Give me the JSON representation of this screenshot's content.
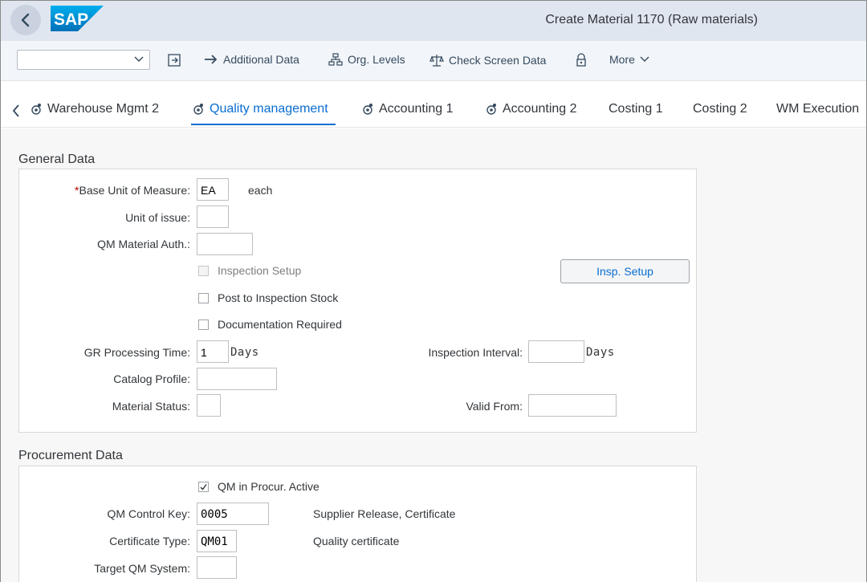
{
  "shell": {
    "title": "Create Material 1170 (Raw materials)",
    "logo_text": "SAP"
  },
  "toolbar": {
    "select_value": "",
    "additional_data": "Additional Data",
    "org_levels": "Org. Levels",
    "check_screen_data": "Check Screen Data",
    "more": "More"
  },
  "tabs": [
    {
      "label": "Warehouse Mgmt 2",
      "icon": "gear-icon"
    },
    {
      "label": "Quality management",
      "icon": "gear-icon",
      "active": true
    },
    {
      "label": "Accounting 1",
      "icon": "gear-icon"
    },
    {
      "label": "Accounting 2",
      "icon": "gear-icon"
    },
    {
      "label": "Costing 1"
    },
    {
      "label": "Costing 2"
    },
    {
      "label": "WM Execution"
    }
  ],
  "general": {
    "title": "General Data",
    "base_uom": {
      "label": "Base Unit of Measure:",
      "value": "EA",
      "text": "each",
      "required": true
    },
    "unit_of_issue": {
      "label": "Unit of issue:",
      "value": ""
    },
    "qm_material_auth": {
      "label": "QM Material Auth.:",
      "value": ""
    },
    "inspection_setup": {
      "label": "Inspection Setup",
      "checked": false,
      "disabled": true
    },
    "insp_setup_button": "Insp. Setup",
    "post_to_inspection_stock": {
      "label": "Post to Inspection Stock",
      "checked": false
    },
    "documentation_required": {
      "label": "Documentation Required",
      "checked": false
    },
    "gr_processing_time": {
      "label": "GR Processing Time:",
      "value": "1",
      "unit": "Days"
    },
    "inspection_interval": {
      "label": "Inspection Interval:",
      "value": "",
      "unit": "Days"
    },
    "catalog_profile": {
      "label": "Catalog Profile:",
      "value": ""
    },
    "material_status": {
      "label": "Material Status:",
      "value": ""
    },
    "valid_from": {
      "label": "Valid From:",
      "value": ""
    }
  },
  "procurement": {
    "title": "Procurement Data",
    "qm_in_procur_active": {
      "label": "QM in Procur. Active",
      "checked": true
    },
    "qm_control_key": {
      "label": "QM Control Key:",
      "value": "0005",
      "text": "Supplier Release, Certificate"
    },
    "certificate_type": {
      "label": "Certificate Type:",
      "value": "QM01",
      "text": "Quality certificate"
    },
    "target_qm_system": {
      "label": "Target QM System:",
      "value": ""
    }
  },
  "colors": {
    "shell_bg": "#dfe6f0",
    "accent": "#0a6ed1",
    "required": "#bb0000",
    "sap_logo": "#0a8ee0"
  }
}
